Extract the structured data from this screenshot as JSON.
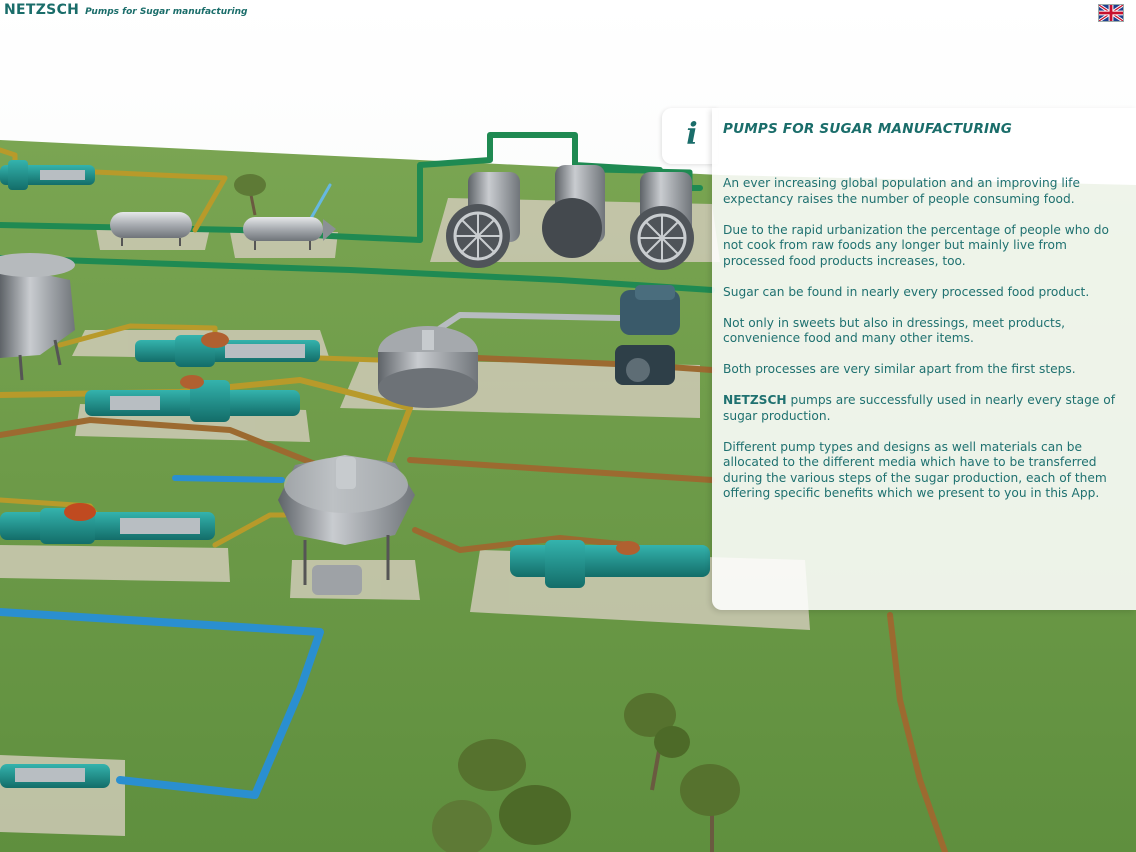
{
  "header": {
    "brand": "NETZSCH",
    "subtitle": "Pumps for Sugar manufacturing"
  },
  "language_flag": {
    "icon": "uk-flag-icon"
  },
  "info_panel": {
    "icon": "info-icon",
    "icon_glyph": "i",
    "title": "PUMPS FOR SUGAR MANUFACTURING",
    "paragraphs": [
      "An ever increasing global population and an improving life expectancy raises the number of people consuming food.",
      "Due to the rapid urbanization the percentage of people who do not cook from raw foods any longer but mainly live from processed food products increases, too.",
      "Sugar can be found in nearly every processed food product.",
      "Not only in sweets but also in dressings, meet products, convenience food and many other items.",
      "Both processes are very similar apart from the first steps."
    ],
    "netzsch_para": {
      "strong": "NETZSCH",
      "rest": " pumps are successfully used in nearly every stage of sugar production."
    },
    "last_para": "Different pump types and designs as well materials can be allocated to the different media which have to be transferred during the various steps of the sugar production, each of them offering specific benefits which we present to you in this App."
  },
  "colors": {
    "brand": "#1a6d6a",
    "ground": "#6b9a48",
    "pump_teal": "#1e8c88",
    "pipe_green": "#1f8a52",
    "pipe_gold": "#b89a2a",
    "pipe_brown": "#9c6a30",
    "pipe_blue": "#2a8fd0"
  }
}
